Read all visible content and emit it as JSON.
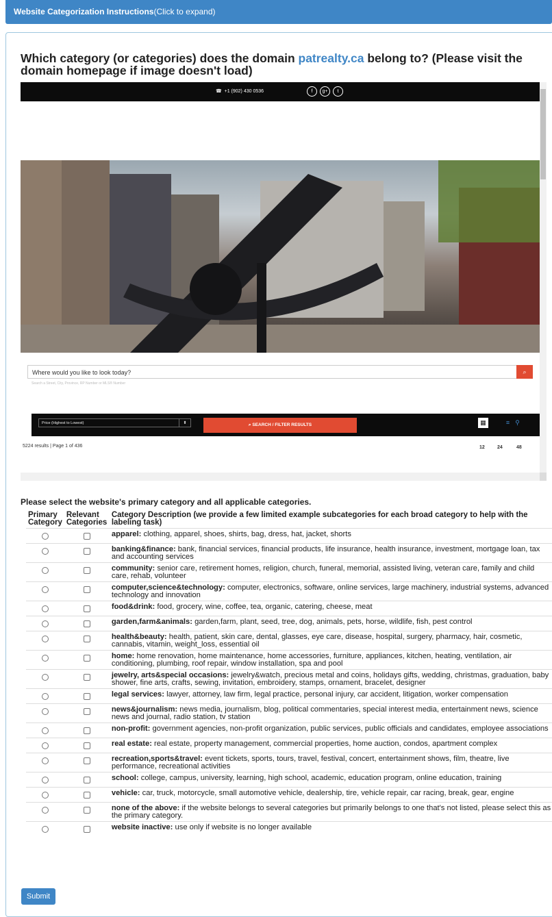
{
  "header": {
    "title": "Website Categorization Instructions",
    "expand_hint": "(Click to expand)"
  },
  "question": {
    "prefix": "Which category (or categories) does the domain ",
    "domain": "patrealty.ca",
    "suffix": " belong to? (Please visit the domain homepage if image doesn't load)"
  },
  "site": {
    "phone": "+1 (902) 430 0536",
    "social_icons": [
      "facebook-icon",
      "google-plus-icon",
      "twitter-icon"
    ],
    "search_placeholder": "Where would you like to look today?",
    "search_hint": "Search a Street, City, Province, RP Number or MLS® Number",
    "sort_value": "Price (Highest to Lowest)",
    "filter_button": "SEARCH / FILTER RESULTS",
    "results_text": "5224 results | Page 1 of 436",
    "per_page": [
      "12",
      "24",
      "48"
    ]
  },
  "instructions": "Please select the website's primary category and all applicable categories.",
  "table": {
    "col_primary": "Primary Category",
    "col_relevant": "Relevant Categories",
    "col_desc": "Category Description (we provide a few limited example subcategories for each broad category to help with the labeling task)",
    "rows": [
      {
        "name": "apparel:",
        "desc": " clothing, apparel, shoes, shirts, bag, dress, hat, jacket, shorts"
      },
      {
        "name": "banking&finance:",
        "desc": " bank, financial services, financial products, life insurance, health insurance, investment, mortgage loan, tax and accounting services"
      },
      {
        "name": "community:",
        "desc": " senior care, retirement homes, religion, church, funeral, memorial, assisted living, veteran care, family and child care, rehab, volunteer"
      },
      {
        "name": "computer,science&technology:",
        "desc": " computer, electronics, software, online services, large machinery, industrial systems, advanced technology and innovation"
      },
      {
        "name": "food&drink:",
        "desc": " food, grocery, wine, coffee, tea, organic, catering, cheese, meat"
      },
      {
        "name": "garden,farm&animals:",
        "desc": " garden,farm, plant, seed, tree, dog, animals, pets, horse, wildlife, fish, pest control"
      },
      {
        "name": "health&beauty:",
        "desc": " health, patient, skin care, dental, glasses, eye care, disease, hospital, surgery, pharmacy, hair, cosmetic, cannabis, vitamin, weight_loss, essential oil"
      },
      {
        "name": "home:",
        "desc": " home renovation, home maintenance, home accessories, furniture, appliances, kitchen, heating, ventilation, air conditioning, plumbing, roof repair, window installation, spa and pool"
      },
      {
        "name": "jewelry, arts&special occasions:",
        "desc": " jewelry&watch, precious metal and coins, holidays gifts, wedding, christmas, graduation, baby shower, fine arts, crafts, sewing, invitation, embroidery, stamps, ornament, bracelet, designer"
      },
      {
        "name": "legal services:",
        "desc": " lawyer, attorney, law firm, legal practice, personal injury, car accident, litigation, worker compensation"
      },
      {
        "name": "news&journalism:",
        "desc": " news media, journalism, blog, political commentaries, special interest media, entertainment news, science news and journal, radio station, tv station"
      },
      {
        "name": "non-profit:",
        "desc": " government agencies, non-profit organization, public services, public officials and candidates, employee associations"
      },
      {
        "name": "real estate:",
        "desc": " real estate, property management, commercial properties, home auction, condos, apartment complex"
      },
      {
        "name": "recreation,sports&travel:",
        "desc": " event tickets, sports, tours, travel, festival, concert, entertainment shows, film, theatre, live performance, recreational activities"
      },
      {
        "name": "school:",
        "desc": " college, campus, university, learning, high school, academic, education program, online education, training"
      },
      {
        "name": "vehicle:",
        "desc": " car, truck, motorcycle, small automotive vehicle, dealership, tire, vehicle repair, car racing, break, gear, engine"
      },
      {
        "name": "none of the above:",
        "desc": " if the website belongs to several categories but primarily belongs to one that's not listed, please select this as the primary category."
      },
      {
        "name": "website inactive:",
        "desc": " use only if website is no longer available"
      }
    ]
  },
  "submit_label": "Submit"
}
